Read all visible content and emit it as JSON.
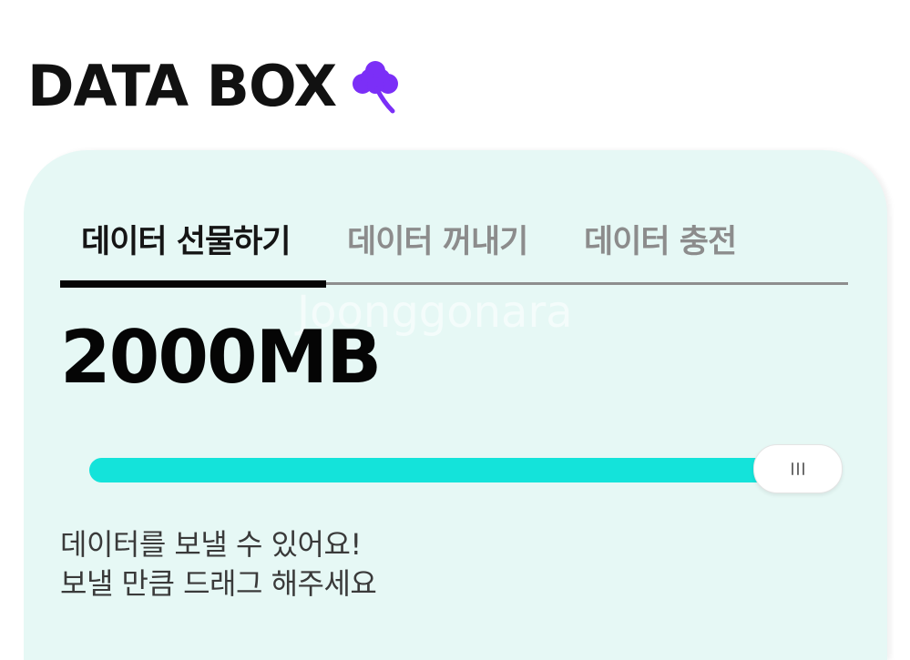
{
  "header": {
    "title": "DATA BOX",
    "logo_icon": "clover-icon",
    "logo_color": "#7b2ff7"
  },
  "tabs": [
    {
      "label": "데이터 선물하기",
      "active": true
    },
    {
      "label": "데이터 꺼내기",
      "active": false
    },
    {
      "label": "데이터 충전",
      "active": false
    }
  ],
  "amount": {
    "value": "2000MB"
  },
  "slider": {
    "fill_fraction": 1.0,
    "fill_color": "#14e3da",
    "handle_icon": "grip-icon"
  },
  "hint": {
    "line1": "데이터를 보낼 수 있어요!",
    "line2": "보낼 만큼 드래그 해주세요"
  },
  "watermark": "Joonggonara",
  "colors": {
    "card_background": "#e6f8f5",
    "accent": "#14e3da",
    "text_primary": "#050505"
  }
}
